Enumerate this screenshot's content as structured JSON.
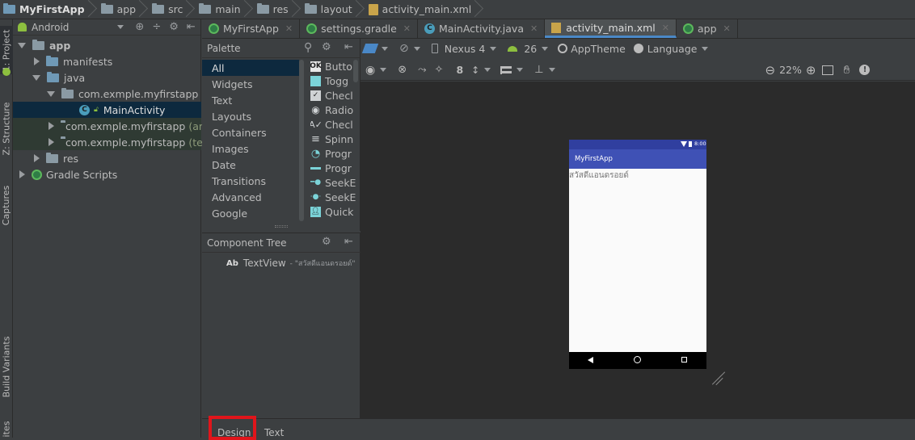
{
  "breadcrumb": {
    "items": [
      "MyFirstApp",
      "app",
      "src",
      "main",
      "res",
      "layout",
      "activity_main.xml"
    ]
  },
  "left_strip": {
    "tabs": [
      "1: Project",
      "Z: Structure",
      "Captures",
      "Build Variants",
      "ites"
    ]
  },
  "project": {
    "view_selector": "Android",
    "tree": [
      {
        "label": "app",
        "suffix": ""
      },
      {
        "label": "manifests",
        "suffix": ""
      },
      {
        "label": "java",
        "suffix": ""
      },
      {
        "label": "com.exmple.myfirstapp",
        "suffix": ""
      },
      {
        "label": "MainActivity",
        "suffix": ""
      },
      {
        "label": "com.exmple.myfirstapp",
        "suffix": "(and"
      },
      {
        "label": "com.exmple.myfirstapp",
        "suffix": "(test"
      },
      {
        "label": "res",
        "suffix": ""
      },
      {
        "label": "Gradle Scripts",
        "suffix": ""
      }
    ]
  },
  "editor_tabs": [
    {
      "label": "MyFirstApp"
    },
    {
      "label": "settings.gradle"
    },
    {
      "label": "MainActivity.java"
    },
    {
      "label": "activity_main.xml"
    },
    {
      "label": "app"
    }
  ],
  "palette": {
    "title": "Palette",
    "categories": [
      "All",
      "Widgets",
      "Text",
      "Layouts",
      "Containers",
      "Images",
      "Date",
      "Transitions",
      "Advanced",
      "Google"
    ],
    "items": [
      "Butto",
      "Togg",
      "Checl",
      "Radio",
      "Checl",
      "Spinn",
      "Progr",
      "Progr",
      "SeekE",
      "SeekE",
      "Quick"
    ]
  },
  "component_tree": {
    "title": "Component Tree",
    "node_prefix": "Ab",
    "node_label": "TextView",
    "node_value": "- \"สวัสดีแอนดรอยด์\""
  },
  "design_toolbar": {
    "device": "Nexus 4",
    "api": "26",
    "theme": "AppTheme",
    "language": "Language",
    "margin": "8",
    "zoom": "22%"
  },
  "phone": {
    "clock": "8:00",
    "app_title": "MyFirstApp",
    "text_view": "สวัสดีแอนดรอยด์",
    "colors": {
      "status": "#303f9f",
      "appbar": "#3f51b5"
    }
  },
  "bottom_tabs": {
    "design": "Design",
    "text": "Text"
  },
  "highlight_color": "#e0151b"
}
